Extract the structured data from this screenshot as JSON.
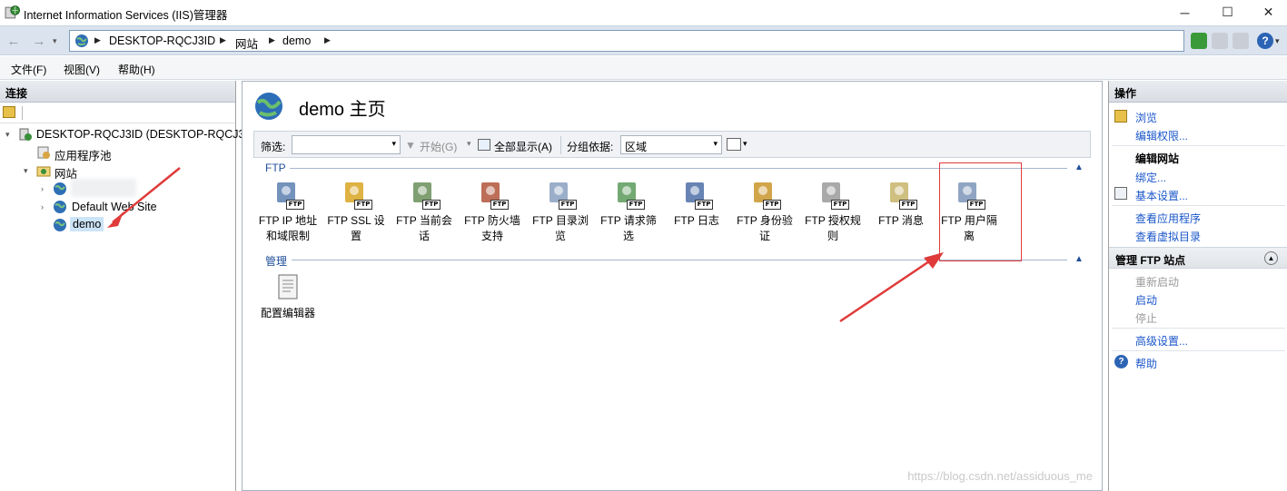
{
  "window": {
    "title": "Internet Information Services (IIS)管理器",
    "minimize": "─",
    "maximize": "☐",
    "close": "✕"
  },
  "address": {
    "crumbs": [
      "DESKTOP-RQCJ3ID",
      "网站",
      "demo"
    ]
  },
  "menu": {
    "file": "文件(F)",
    "view": "视图(V)",
    "help": "帮助(H)"
  },
  "connections": {
    "header": "连接",
    "tree": {
      "server": "DESKTOP-RQCJ3ID (DESKTOP-RQCJ3",
      "app_pools": "应用程序池",
      "sites": "网站",
      "site_default": "Default Web Site",
      "site_demo": "demo"
    }
  },
  "center": {
    "title": "demo 主页",
    "filter_label": "筛选:",
    "start_label": "开始(G)",
    "show_all_label": "全部显示(A)",
    "group_by_label": "分组依据:",
    "group_by_value": "区域",
    "groups": {
      "ftp": "FTP",
      "manage": "管理"
    },
    "ftp_features": [
      {
        "label": "FTP IP 地址和域限制",
        "icon": "ip-restriction-icon"
      },
      {
        "label": "FTP SSL 设置",
        "icon": "ssl-lock-icon"
      },
      {
        "label": "FTP 当前会话",
        "icon": "sessions-icon"
      },
      {
        "label": "FTP 防火墙支持",
        "icon": "firewall-icon"
      },
      {
        "label": "FTP 目录浏览",
        "icon": "directory-browse-icon"
      },
      {
        "label": "FTP 请求筛选",
        "icon": "request-filter-icon"
      },
      {
        "label": "FTP 日志",
        "icon": "log-icon"
      },
      {
        "label": "FTP 身份验证",
        "icon": "authentication-icon"
      },
      {
        "label": "FTP 授权规则",
        "icon": "authorization-icon"
      },
      {
        "label": "FTP 消息",
        "icon": "messages-icon"
      },
      {
        "label": "FTP 用户隔离",
        "icon": "user-isolation-icon"
      }
    ],
    "manage_features": [
      {
        "label": "配置编辑器",
        "icon": "config-editor-icon"
      }
    ]
  },
  "actions": {
    "header": "操作",
    "browse": "浏览",
    "edit_permissions": "编辑权限...",
    "edit_site": "编辑网站",
    "bindings": "绑定...",
    "basic_settings": "基本设置...",
    "view_applications": "查看应用程序",
    "view_virtual_dirs": "查看虚拟目录",
    "manage_ftp_header": "管理 FTP 站点",
    "restart": "重新启动",
    "start": "启动",
    "stop": "停止",
    "advanced_settings": "高级设置...",
    "help": "帮助"
  },
  "watermark": "https://blog.csdn.net/assiduous_me",
  "colors": {
    "link": "#1a56c9",
    "annotation_red": "#e03a3a",
    "group_blue": "#1f4e99"
  }
}
